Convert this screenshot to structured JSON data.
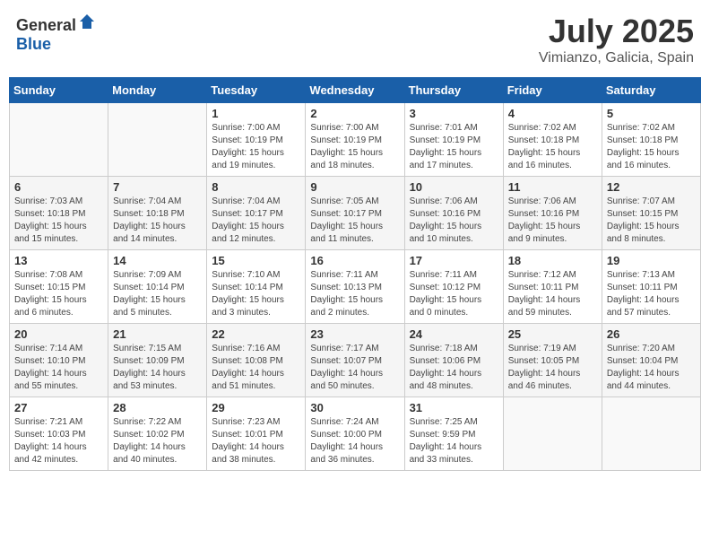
{
  "header": {
    "logo_general": "General",
    "logo_blue": "Blue",
    "month_year": "July 2025",
    "location": "Vimianzo, Galicia, Spain"
  },
  "weekdays": [
    "Sunday",
    "Monday",
    "Tuesday",
    "Wednesday",
    "Thursday",
    "Friday",
    "Saturday"
  ],
  "weeks": [
    [
      {
        "day": "",
        "detail": ""
      },
      {
        "day": "",
        "detail": ""
      },
      {
        "day": "1",
        "detail": "Sunrise: 7:00 AM\nSunset: 10:19 PM\nDaylight: 15 hours\nand 19 minutes."
      },
      {
        "day": "2",
        "detail": "Sunrise: 7:00 AM\nSunset: 10:19 PM\nDaylight: 15 hours\nand 18 minutes."
      },
      {
        "day": "3",
        "detail": "Sunrise: 7:01 AM\nSunset: 10:19 PM\nDaylight: 15 hours\nand 17 minutes."
      },
      {
        "day": "4",
        "detail": "Sunrise: 7:02 AM\nSunset: 10:18 PM\nDaylight: 15 hours\nand 16 minutes."
      },
      {
        "day": "5",
        "detail": "Sunrise: 7:02 AM\nSunset: 10:18 PM\nDaylight: 15 hours\nand 16 minutes."
      }
    ],
    [
      {
        "day": "6",
        "detail": "Sunrise: 7:03 AM\nSunset: 10:18 PM\nDaylight: 15 hours\nand 15 minutes."
      },
      {
        "day": "7",
        "detail": "Sunrise: 7:04 AM\nSunset: 10:18 PM\nDaylight: 15 hours\nand 14 minutes."
      },
      {
        "day": "8",
        "detail": "Sunrise: 7:04 AM\nSunset: 10:17 PM\nDaylight: 15 hours\nand 12 minutes."
      },
      {
        "day": "9",
        "detail": "Sunrise: 7:05 AM\nSunset: 10:17 PM\nDaylight: 15 hours\nand 11 minutes."
      },
      {
        "day": "10",
        "detail": "Sunrise: 7:06 AM\nSunset: 10:16 PM\nDaylight: 15 hours\nand 10 minutes."
      },
      {
        "day": "11",
        "detail": "Sunrise: 7:06 AM\nSunset: 10:16 PM\nDaylight: 15 hours\nand 9 minutes."
      },
      {
        "day": "12",
        "detail": "Sunrise: 7:07 AM\nSunset: 10:15 PM\nDaylight: 15 hours\nand 8 minutes."
      }
    ],
    [
      {
        "day": "13",
        "detail": "Sunrise: 7:08 AM\nSunset: 10:15 PM\nDaylight: 15 hours\nand 6 minutes."
      },
      {
        "day": "14",
        "detail": "Sunrise: 7:09 AM\nSunset: 10:14 PM\nDaylight: 15 hours\nand 5 minutes."
      },
      {
        "day": "15",
        "detail": "Sunrise: 7:10 AM\nSunset: 10:14 PM\nDaylight: 15 hours\nand 3 minutes."
      },
      {
        "day": "16",
        "detail": "Sunrise: 7:11 AM\nSunset: 10:13 PM\nDaylight: 15 hours\nand 2 minutes."
      },
      {
        "day": "17",
        "detail": "Sunrise: 7:11 AM\nSunset: 10:12 PM\nDaylight: 15 hours\nand 0 minutes."
      },
      {
        "day": "18",
        "detail": "Sunrise: 7:12 AM\nSunset: 10:11 PM\nDaylight: 14 hours\nand 59 minutes."
      },
      {
        "day": "19",
        "detail": "Sunrise: 7:13 AM\nSunset: 10:11 PM\nDaylight: 14 hours\nand 57 minutes."
      }
    ],
    [
      {
        "day": "20",
        "detail": "Sunrise: 7:14 AM\nSunset: 10:10 PM\nDaylight: 14 hours\nand 55 minutes."
      },
      {
        "day": "21",
        "detail": "Sunrise: 7:15 AM\nSunset: 10:09 PM\nDaylight: 14 hours\nand 53 minutes."
      },
      {
        "day": "22",
        "detail": "Sunrise: 7:16 AM\nSunset: 10:08 PM\nDaylight: 14 hours\nand 51 minutes."
      },
      {
        "day": "23",
        "detail": "Sunrise: 7:17 AM\nSunset: 10:07 PM\nDaylight: 14 hours\nand 50 minutes."
      },
      {
        "day": "24",
        "detail": "Sunrise: 7:18 AM\nSunset: 10:06 PM\nDaylight: 14 hours\nand 48 minutes."
      },
      {
        "day": "25",
        "detail": "Sunrise: 7:19 AM\nSunset: 10:05 PM\nDaylight: 14 hours\nand 46 minutes."
      },
      {
        "day": "26",
        "detail": "Sunrise: 7:20 AM\nSunset: 10:04 PM\nDaylight: 14 hours\nand 44 minutes."
      }
    ],
    [
      {
        "day": "27",
        "detail": "Sunrise: 7:21 AM\nSunset: 10:03 PM\nDaylight: 14 hours\nand 42 minutes."
      },
      {
        "day": "28",
        "detail": "Sunrise: 7:22 AM\nSunset: 10:02 PM\nDaylight: 14 hours\nand 40 minutes."
      },
      {
        "day": "29",
        "detail": "Sunrise: 7:23 AM\nSunset: 10:01 PM\nDaylight: 14 hours\nand 38 minutes."
      },
      {
        "day": "30",
        "detail": "Sunrise: 7:24 AM\nSunset: 10:00 PM\nDaylight: 14 hours\nand 36 minutes."
      },
      {
        "day": "31",
        "detail": "Sunrise: 7:25 AM\nSunset: 9:59 PM\nDaylight: 14 hours\nand 33 minutes."
      },
      {
        "day": "",
        "detail": ""
      },
      {
        "day": "",
        "detail": ""
      }
    ]
  ]
}
